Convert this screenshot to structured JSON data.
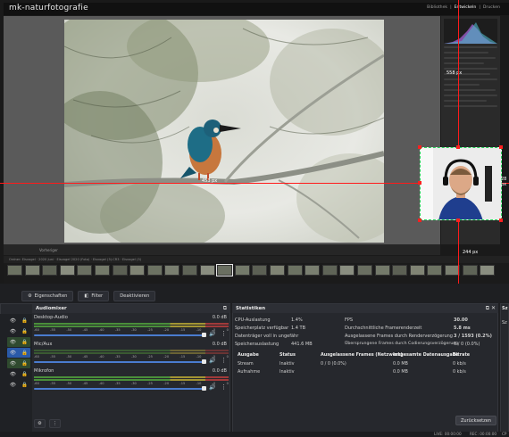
{
  "lightroom": {
    "logo": "mk-naturfotografie",
    "modules": [
      "Bibliothek",
      "Entwickeln",
      "Drucken"
    ],
    "active_module": "Entwickeln",
    "histogram_label": "Histogramm",
    "crop_label": "Freistellen",
    "cam_px_label": "558 px",
    "cam_px_right": "28 px",
    "cam_px_bottom": "244 px",
    "crop_readout": "453 px",
    "preview_label": "Vorheriger",
    "filmstrip_path": "Ordner: Eisvogel · 2020 Juni  ·  Eisvogel 2020 (Foto) · Eisvogel (3).CR3 · Eisvogel (3)",
    "colors": {
      "guide": "#ff1a1a",
      "crop_border": "#27d35a"
    }
  },
  "obs": {
    "source_buttons": [
      {
        "icon": "gear-icon",
        "label": "Eigenschaften"
      },
      {
        "icon": "filter-icon",
        "label": "Filter"
      },
      {
        "icon": "",
        "label": "Deaktivieren"
      }
    ],
    "mixer": {
      "title": "Audiomixer",
      "scale": [
        "-60",
        "-55",
        "-50",
        "-45",
        "-40",
        "-35",
        "-30",
        "-25",
        "-20",
        "-15",
        "-10",
        "-5",
        "0"
      ],
      "channels": [
        {
          "name": "Desktop-Audio",
          "db": "0.0 dB"
        },
        {
          "name": "Mic/Aux",
          "db": "0.0 dB"
        },
        {
          "name": "Mikrofon",
          "db": "0.0 dB"
        }
      ]
    },
    "stats": {
      "title": "Statistiken",
      "left": [
        {
          "label": "CPU-Auslastung",
          "value": "1.4%"
        },
        {
          "label": "Speicherplatz verfügbar",
          "value": "1.4 TB"
        },
        {
          "label": "Datenträger voll in ungefähr",
          "value": ""
        },
        {
          "label": "Speicherauslastung",
          "value": "441.6 MB"
        }
      ],
      "right": [
        {
          "label": "FPS",
          "value": "30.00"
        },
        {
          "label": "Durchschnittliche Framerenderzeit",
          "value": "5.8 ms"
        },
        {
          "label": "Ausgelassene Frames durch Renderverzögerung",
          "value": "3 / 1593 (0.2%)"
        },
        {
          "label": "Übersprungene Frames durch Codierungsverzögerung",
          "value": "0 / 0 (0.0%)"
        }
      ],
      "output_headers": [
        "Ausgabe",
        "Status",
        "Ausgelassene Frames (Netzwerk)",
        "Insgesamte Datenausgabe",
        "Bitrate"
      ],
      "outputs": [
        [
          "Stream",
          "Inaktiv",
          "0 / 0 (0.0%)",
          "0.0 MB",
          "0 kb/s"
        ],
        [
          "Aufnahme",
          "Inaktiv",
          "",
          "0.0 MB",
          "0 kb/s"
        ]
      ],
      "reset_label": "Zurücksetzen"
    },
    "side_panel_label": "Sz",
    "side_panel_item": "Sz",
    "status": {
      "live": "LIVE: 00:00:00",
      "rec": "REC: 00:00:00",
      "cpu": "CP"
    }
  }
}
